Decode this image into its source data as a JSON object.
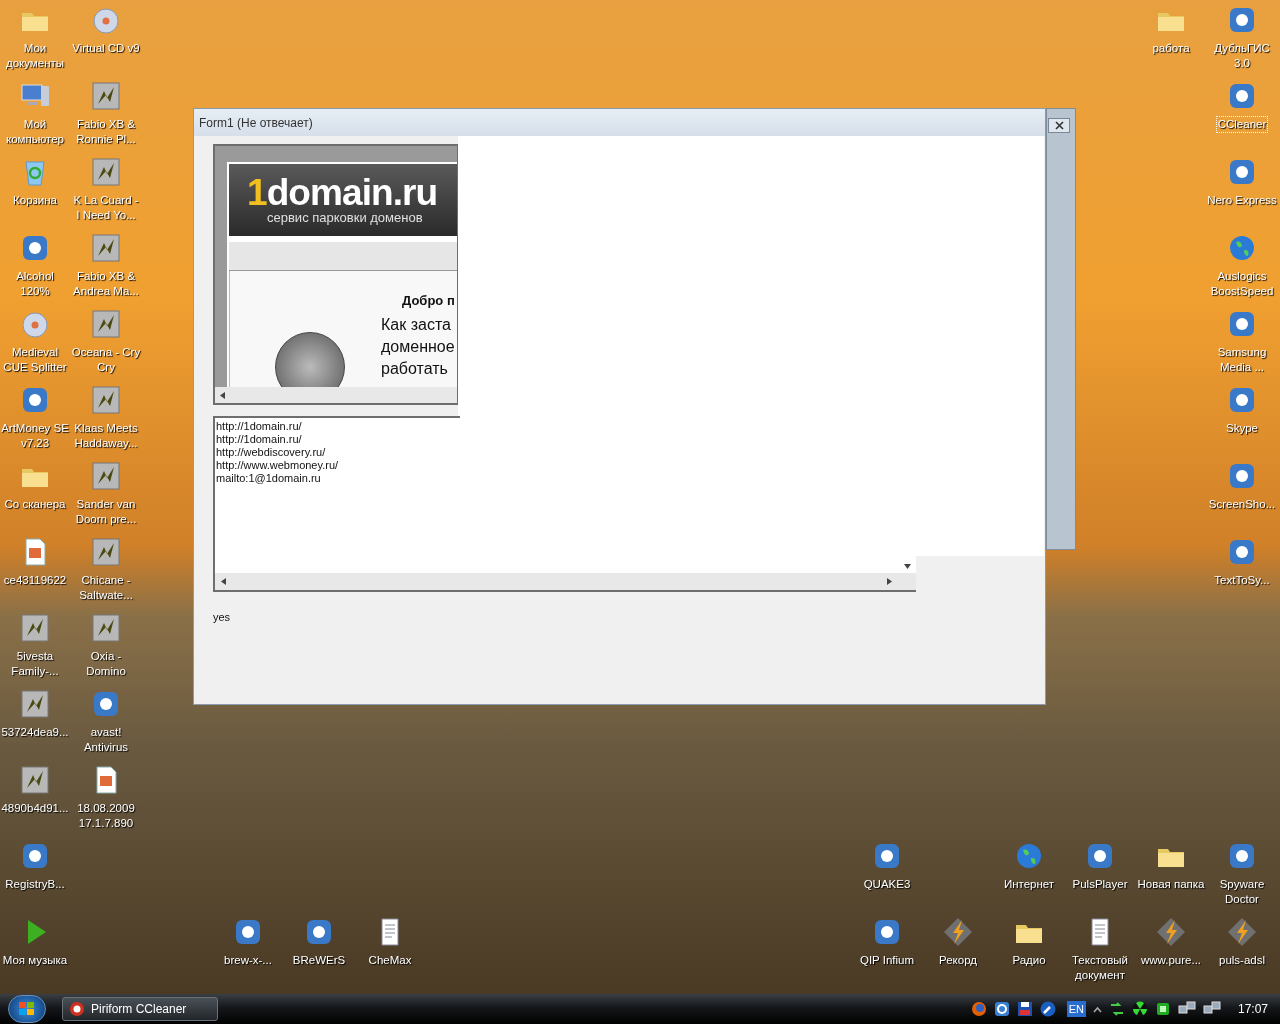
{
  "desktop_icons": [
    {
      "label": "Мои документы",
      "kind": "folder",
      "selected": false
    },
    {
      "label": "Мой компьютер",
      "kind": "computer",
      "selected": false
    },
    {
      "label": "Корзина",
      "kind": "bin",
      "selected": false
    },
    {
      "label": "Alcohol 120%",
      "kind": "app",
      "selected": false
    },
    {
      "label": "Medieval CUE Splitter",
      "kind": "disc",
      "selected": false
    },
    {
      "label": "ArtMoney SE v7.23",
      "kind": "app",
      "selected": false
    },
    {
      "label": "Со сканера",
      "kind": "folder",
      "selected": false
    },
    {
      "label": "ce43119622",
      "kind": "image",
      "selected": false
    },
    {
      "label": "5ivesta Family-...",
      "kind": "media",
      "selected": false
    },
    {
      "label": "53724dea9...",
      "kind": "media",
      "selected": false
    },
    {
      "label": "4890b4d91...",
      "kind": "media",
      "selected": false
    },
    {
      "label": "RegistryB...",
      "kind": "app",
      "selected": false
    },
    {
      "label": "Моя музыка",
      "kind": "play",
      "selected": false
    },
    {
      "label": "Virtual CD v9",
      "kind": "disc",
      "selected": false
    },
    {
      "label": "Fabio XB & Ronnie Pl...",
      "kind": "media",
      "selected": false
    },
    {
      "label": "K La Cuard - I Need Yo...",
      "kind": "media",
      "selected": false
    },
    {
      "label": "Fabio XB & Andrea Ma...",
      "kind": "media",
      "selected": false
    },
    {
      "label": "Oceana - Cry Cry",
      "kind": "media",
      "selected": false
    },
    {
      "label": "Klaas Meets Haddaway...",
      "kind": "media",
      "selected": false
    },
    {
      "label": "Sander van Doorn pre...",
      "kind": "media",
      "selected": false
    },
    {
      "label": "Chicane - Saltwate...",
      "kind": "media",
      "selected": false
    },
    {
      "label": "Oxia - Domino",
      "kind": "media",
      "selected": false
    },
    {
      "label": "avast! Antivirus",
      "kind": "app",
      "selected": false
    },
    {
      "label": "18.08.2009 17.1.7.890",
      "kind": "image",
      "selected": false
    },
    {
      "label": "brew-x-...",
      "kind": "app",
      "selected": false
    },
    {
      "label": "BReWErS",
      "kind": "app",
      "selected": false
    },
    {
      "label": "CheMax",
      "kind": "document",
      "selected": false
    },
    {
      "label": "работа",
      "kind": "folder",
      "selected": false
    },
    {
      "label": "ДубльГИС 3.0",
      "kind": "app",
      "selected": false
    },
    {
      "label": "CCleaner",
      "kind": "app",
      "selected": true
    },
    {
      "label": "Nero Express",
      "kind": "app",
      "selected": false
    },
    {
      "label": "Auslogics BoostSpeed",
      "kind": "globe",
      "selected": false
    },
    {
      "label": "Samsung Media ...",
      "kind": "app",
      "selected": false
    },
    {
      "label": "Skype",
      "kind": "app",
      "selected": false
    },
    {
      "label": "ScreenSho...",
      "kind": "app",
      "selected": false
    },
    {
      "label": "TextToSy...",
      "kind": "app",
      "selected": false
    },
    {
      "label": "QUAKE3",
      "kind": "app",
      "selected": false
    },
    {
      "label": "Интернет",
      "kind": "globe",
      "selected": false
    },
    {
      "label": "PulsPlayer",
      "kind": "app",
      "selected": false
    },
    {
      "label": "Новая папка",
      "kind": "folder",
      "selected": false
    },
    {
      "label": "Spyware Doctor",
      "kind": "app",
      "selected": false
    },
    {
      "label": "QIP Infium",
      "kind": "app",
      "selected": false
    },
    {
      "label": "Рекорд",
      "kind": "bolt",
      "selected": false
    },
    {
      "label": "Радио",
      "kind": "folder",
      "selected": false
    },
    {
      "label": "Текстовый документ",
      "kind": "document",
      "selected": false
    },
    {
      "label": "www.pure...",
      "kind": "bolt",
      "selected": false
    },
    {
      "label": "puls-adsl",
      "kind": "bolt",
      "selected": false
    }
  ],
  "window": {
    "title": "Form1 (Не отвечает)",
    "browser": {
      "logo": "1domain.ru",
      "tagline": "сервис парковки доменов",
      "welcome": "Добро п",
      "paragraph_lines": [
        "Как заста",
        "доменное",
        "работать"
      ]
    },
    "links_box": {
      "lines": [
        "http://1domain.ru/",
        "http://1domain.ru/",
        "http://webdiscovery.ru/",
        "http://www.webmoney.ru/",
        "mailto:1@1domain.ru"
      ]
    },
    "status_label": "yes"
  },
  "taskbar": {
    "tasks": [
      {
        "label": "Piriform CCleaner"
      }
    ],
    "tray": {
      "language": "EN",
      "clock": "17:07"
    }
  }
}
